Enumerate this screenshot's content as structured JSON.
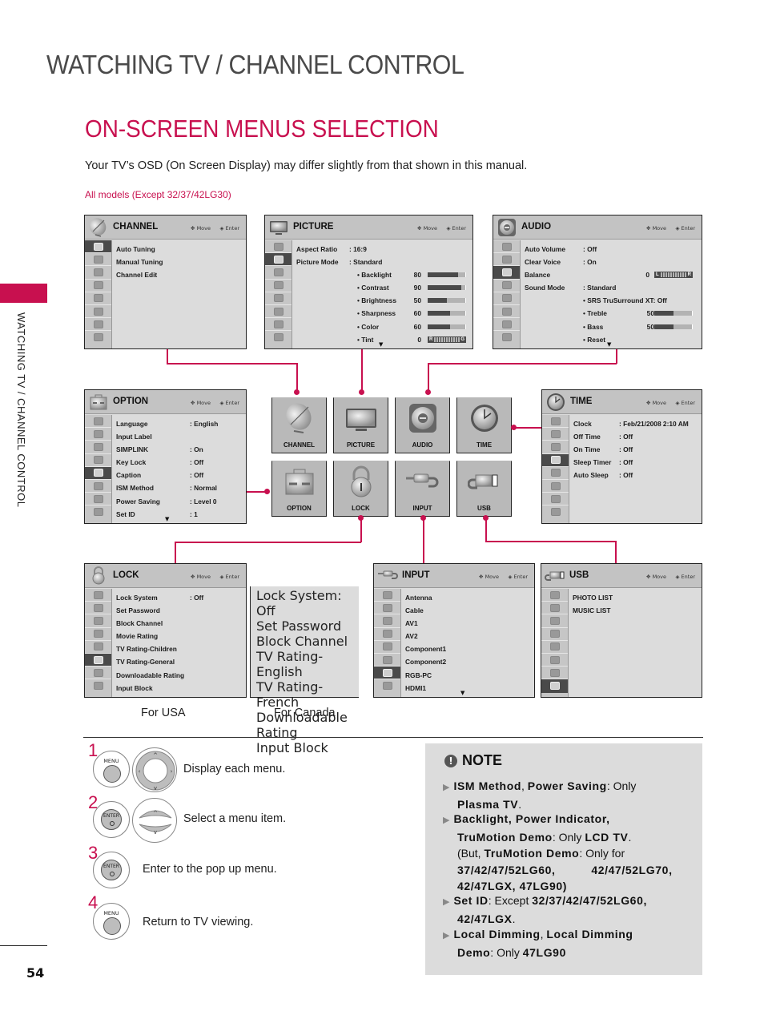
{
  "page": {
    "title": "WATCHING TV / CHANNEL CONTROL",
    "section_title": "ON-SCREEN MENUS SELECTION",
    "intro": "Your TV’s OSD (On Screen Display) may differ slightly from that shown in this manual.",
    "models_note": "All models (Except 32/37/42LG30)",
    "side_label": "WATCHING TV / CHANNEL CONTROL",
    "page_number": "54",
    "accent_color": "#c8104f"
  },
  "osd_common": {
    "move_label": "Move",
    "enter_label": "Enter"
  },
  "menus": {
    "channel": {
      "title": "CHANNEL",
      "rows": [
        {
          "label": "Auto Tuning"
        },
        {
          "label": "Manual Tuning"
        },
        {
          "label": "Channel Edit"
        }
      ]
    },
    "picture": {
      "title": "PICTURE",
      "rows": [
        {
          "label": "Aspect Ratio",
          "value": ": 16:9"
        },
        {
          "label": "Picture Mode",
          "value": ": Standard"
        }
      ],
      "sliders": [
        {
          "label": "• Backlight",
          "value": "80",
          "level": 80
        },
        {
          "label": "• Contrast",
          "value": "90",
          "level": 90
        },
        {
          "label": "• Brightness",
          "value": "50",
          "level": 50
        },
        {
          "label": "• Sharpness",
          "value": "60",
          "level": 60
        },
        {
          "label": "• Color",
          "value": "60",
          "level": 60
        }
      ],
      "tint": {
        "label": "• Tint",
        "value": "0",
        "left": "R",
        "right": "G"
      }
    },
    "audio": {
      "title": "AUDIO",
      "rows": [
        {
          "label": "Auto Volume",
          "value": ": Off"
        },
        {
          "label": "Clear Voice",
          "value": ": On"
        },
        {
          "label": "Balance",
          "value": "0",
          "left": "L",
          "right": "R"
        },
        {
          "label": "Sound Mode",
          "value": ": Standard"
        }
      ],
      "srs": "• SRS TruSurround XT:  Off",
      "sliders": [
        {
          "label": "• Treble",
          "value": "50",
          "level": 50
        },
        {
          "label": "• Bass",
          "value": "50",
          "level": 50
        }
      ],
      "reset": "• Reset"
    },
    "option": {
      "title": "OPTION",
      "rows": [
        {
          "label": "Language",
          "value": ": English"
        },
        {
          "label": "Input Label",
          "value": ""
        },
        {
          "label": "SIMPLINK",
          "value": ": On"
        },
        {
          "label": "Key Lock",
          "value": ": Off"
        },
        {
          "label": "Caption",
          "value": ": Off"
        },
        {
          "label": "ISM Method",
          "value": ": Normal"
        },
        {
          "label": "Power Saving",
          "value": ": Level 0"
        },
        {
          "label": "Set ID",
          "value": ": 1"
        }
      ]
    },
    "time": {
      "title": "TIME",
      "rows": [
        {
          "label": "Clock",
          "value": ": Feb/21/2008  2:10 AM"
        },
        {
          "label": "Off Time",
          "value": ": Off"
        },
        {
          "label": "On Time",
          "value": ": Off"
        },
        {
          "label": "Sleep Timer",
          "value": ": Off"
        },
        {
          "label": "Auto Sleep",
          "value": ": Off"
        }
      ]
    },
    "lock_usa": {
      "title": "LOCK",
      "caption": "For USA",
      "rows": [
        {
          "label": "Lock System",
          "value": ": Off"
        },
        {
          "label": "Set Password",
          "value": ""
        },
        {
          "label": "Block Channel",
          "value": ""
        },
        {
          "label": "Movie Rating",
          "value": ""
        },
        {
          "label": "TV Rating-Children",
          "value": ""
        },
        {
          "label": "TV Rating-General",
          "value": ""
        },
        {
          "label": "Downloadable Rating",
          "value": ""
        },
        {
          "label": "Input Block",
          "value": ""
        }
      ]
    },
    "lock_canada": {
      "caption": "For Canada",
      "rows": [
        {
          "label": "Lock System",
          "value": ": Off"
        },
        {
          "label": "Set Password",
          "value": ""
        },
        {
          "label": "Block Channel",
          "value": ""
        },
        {
          "label": "TV Rating-English",
          "value": ""
        },
        {
          "label": "TV Rating-French",
          "value": ""
        },
        {
          "label": "Downloadable Rating",
          "value": ""
        },
        {
          "label": "Input Block",
          "value": ""
        }
      ]
    },
    "input": {
      "title": "INPUT",
      "rows": [
        {
          "label": "Antenna"
        },
        {
          "label": "Cable"
        },
        {
          "label": "AV1"
        },
        {
          "label": "AV2"
        },
        {
          "label": "Component1"
        },
        {
          "label": "Component2"
        },
        {
          "label": "RGB-PC"
        },
        {
          "label": "HDMI1"
        }
      ]
    },
    "usb": {
      "title": "USB",
      "rows": [
        {
          "label": "PHOTO LIST"
        },
        {
          "label": "MUSIC LIST"
        }
      ]
    }
  },
  "main_menu_tiles": [
    "CHANNEL",
    "PICTURE",
    "AUDIO",
    "TIME",
    "OPTION",
    "LOCK",
    "INPUT",
    "USB"
  ],
  "steps": [
    {
      "number": "1",
      "button": "MENU",
      "text": "Display each menu."
    },
    {
      "number": "2",
      "button": "ENTER",
      "text": "Select a menu item."
    },
    {
      "number": "3",
      "button": "ENTER",
      "text": "Enter to the pop up menu."
    },
    {
      "number": "4",
      "button": "MENU",
      "text": "Return to TV viewing."
    }
  ],
  "note": {
    "title": "NOTE",
    "items": [
      {
        "bold1": "ISM Method",
        "sep": ", ",
        "bold2": "Power Saving",
        "rest": ": Only",
        "line2_bold": "Plasma TV",
        "line2_rest": "."
      },
      {
        "bold1": "Backlight, Power Indicator,",
        "line2_bold": "TruMotion Demo",
        "line2_rest": ": Only ",
        "line2_bold2": "LCD TV",
        "line2_end": ".",
        "line3": "(But, ",
        "line3_bold": "TruMotion  Demo",
        "line3_rest": ":  Only  for",
        "line4": "37/42/47/52LG60,          42/47/52LG70,",
        "line5": "42/47LGX, 47LG90)"
      },
      {
        "bold1": "Set ID",
        "rest": ": Except ",
        "bold2": "32/37/42/47/52LG60,",
        "line2_bold": "42/47LGX",
        "line2_rest": "."
      },
      {
        "bold1": "Local Dimming",
        "sep": ", ",
        "bold2": "Local Dimming",
        "line2_bold": "Demo",
        "line2_rest": ": Only ",
        "line2_bold2": "47LG90"
      }
    ]
  }
}
